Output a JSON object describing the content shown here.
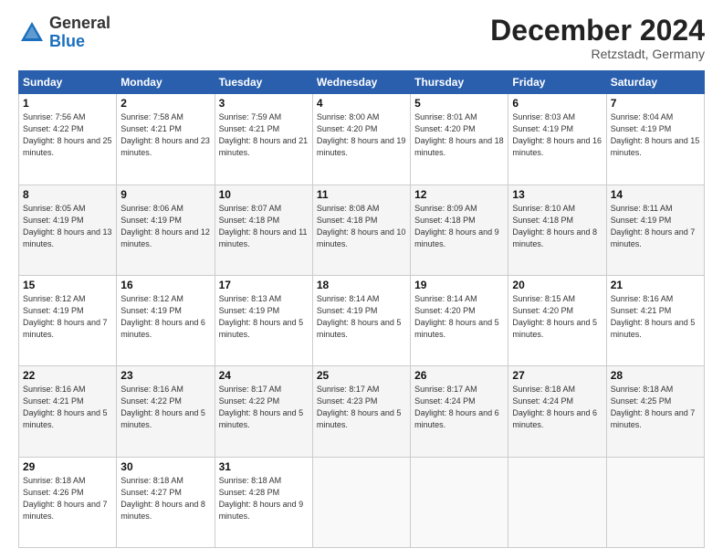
{
  "logo": {
    "general": "General",
    "blue": "Blue"
  },
  "header": {
    "month": "December 2024",
    "location": "Retzstadt, Germany"
  },
  "days_of_week": [
    "Sunday",
    "Monday",
    "Tuesday",
    "Wednesday",
    "Thursday",
    "Friday",
    "Saturday"
  ],
  "weeks": [
    [
      {
        "day": "1",
        "sunrise": "7:56 AM",
        "sunset": "4:22 PM",
        "daylight": "8 hours and 25 minutes."
      },
      {
        "day": "2",
        "sunrise": "7:58 AM",
        "sunset": "4:21 PM",
        "daylight": "8 hours and 23 minutes."
      },
      {
        "day": "3",
        "sunrise": "7:59 AM",
        "sunset": "4:21 PM",
        "daylight": "8 hours and 21 minutes."
      },
      {
        "day": "4",
        "sunrise": "8:00 AM",
        "sunset": "4:20 PM",
        "daylight": "8 hours and 19 minutes."
      },
      {
        "day": "5",
        "sunrise": "8:01 AM",
        "sunset": "4:20 PM",
        "daylight": "8 hours and 18 minutes."
      },
      {
        "day": "6",
        "sunrise": "8:03 AM",
        "sunset": "4:19 PM",
        "daylight": "8 hours and 16 minutes."
      },
      {
        "day": "7",
        "sunrise": "8:04 AM",
        "sunset": "4:19 PM",
        "daylight": "8 hours and 15 minutes."
      }
    ],
    [
      {
        "day": "8",
        "sunrise": "8:05 AM",
        "sunset": "4:19 PM",
        "daylight": "8 hours and 13 minutes."
      },
      {
        "day": "9",
        "sunrise": "8:06 AM",
        "sunset": "4:19 PM",
        "daylight": "8 hours and 12 minutes."
      },
      {
        "day": "10",
        "sunrise": "8:07 AM",
        "sunset": "4:18 PM",
        "daylight": "8 hours and 11 minutes."
      },
      {
        "day": "11",
        "sunrise": "8:08 AM",
        "sunset": "4:18 PM",
        "daylight": "8 hours and 10 minutes."
      },
      {
        "day": "12",
        "sunrise": "8:09 AM",
        "sunset": "4:18 PM",
        "daylight": "8 hours and 9 minutes."
      },
      {
        "day": "13",
        "sunrise": "8:10 AM",
        "sunset": "4:18 PM",
        "daylight": "8 hours and 8 minutes."
      },
      {
        "day": "14",
        "sunrise": "8:11 AM",
        "sunset": "4:19 PM",
        "daylight": "8 hours and 7 minutes."
      }
    ],
    [
      {
        "day": "15",
        "sunrise": "8:12 AM",
        "sunset": "4:19 PM",
        "daylight": "8 hours and 7 minutes."
      },
      {
        "day": "16",
        "sunrise": "8:12 AM",
        "sunset": "4:19 PM",
        "daylight": "8 hours and 6 minutes."
      },
      {
        "day": "17",
        "sunrise": "8:13 AM",
        "sunset": "4:19 PM",
        "daylight": "8 hours and 5 minutes."
      },
      {
        "day": "18",
        "sunrise": "8:14 AM",
        "sunset": "4:19 PM",
        "daylight": "8 hours and 5 minutes."
      },
      {
        "day": "19",
        "sunrise": "8:14 AM",
        "sunset": "4:20 PM",
        "daylight": "8 hours and 5 minutes."
      },
      {
        "day": "20",
        "sunrise": "8:15 AM",
        "sunset": "4:20 PM",
        "daylight": "8 hours and 5 minutes."
      },
      {
        "day": "21",
        "sunrise": "8:16 AM",
        "sunset": "4:21 PM",
        "daylight": "8 hours and 5 minutes."
      }
    ],
    [
      {
        "day": "22",
        "sunrise": "8:16 AM",
        "sunset": "4:21 PM",
        "daylight": "8 hours and 5 minutes."
      },
      {
        "day": "23",
        "sunrise": "8:16 AM",
        "sunset": "4:22 PM",
        "daylight": "8 hours and 5 minutes."
      },
      {
        "day": "24",
        "sunrise": "8:17 AM",
        "sunset": "4:22 PM",
        "daylight": "8 hours and 5 minutes."
      },
      {
        "day": "25",
        "sunrise": "8:17 AM",
        "sunset": "4:23 PM",
        "daylight": "8 hours and 5 minutes."
      },
      {
        "day": "26",
        "sunrise": "8:17 AM",
        "sunset": "4:24 PM",
        "daylight": "8 hours and 6 minutes."
      },
      {
        "day": "27",
        "sunrise": "8:18 AM",
        "sunset": "4:24 PM",
        "daylight": "8 hours and 6 minutes."
      },
      {
        "day": "28",
        "sunrise": "8:18 AM",
        "sunset": "4:25 PM",
        "daylight": "8 hours and 7 minutes."
      }
    ],
    [
      {
        "day": "29",
        "sunrise": "8:18 AM",
        "sunset": "4:26 PM",
        "daylight": "8 hours and 7 minutes."
      },
      {
        "day": "30",
        "sunrise": "8:18 AM",
        "sunset": "4:27 PM",
        "daylight": "8 hours and 8 minutes."
      },
      {
        "day": "31",
        "sunrise": "8:18 AM",
        "sunset": "4:28 PM",
        "daylight": "8 hours and 9 minutes."
      },
      null,
      null,
      null,
      null
    ]
  ]
}
